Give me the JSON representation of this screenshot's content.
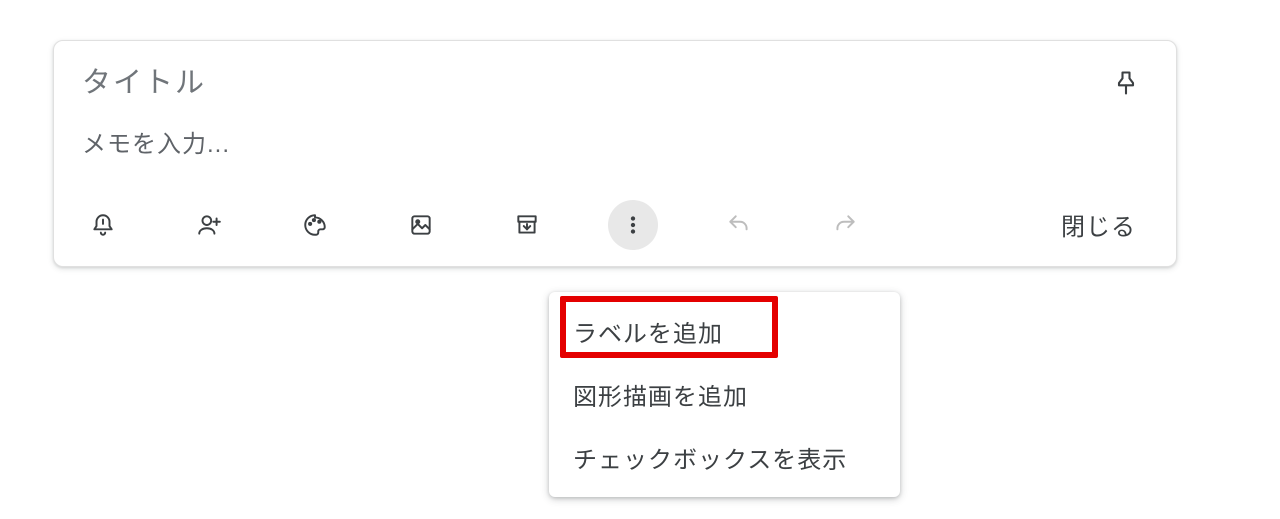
{
  "note": {
    "title_placeholder": "タイトル",
    "title_value": "",
    "body_placeholder": "メモを入力...",
    "body_value": "",
    "close_label": "閉じる"
  },
  "toolbar": {
    "reminder_name": "reminder-icon",
    "collaborator_name": "collaborator-icon",
    "palette_name": "palette-icon",
    "image_name": "image-icon",
    "archive_name": "archive-icon",
    "more_name": "more-icon",
    "undo_name": "undo-icon",
    "redo_name": "redo-icon"
  },
  "dropdown": {
    "items": [
      {
        "label": "ラベルを追加"
      },
      {
        "label": "図形描画を追加"
      },
      {
        "label": "チェックボックスを表示"
      }
    ]
  },
  "highlight": {
    "target_index": 0
  }
}
